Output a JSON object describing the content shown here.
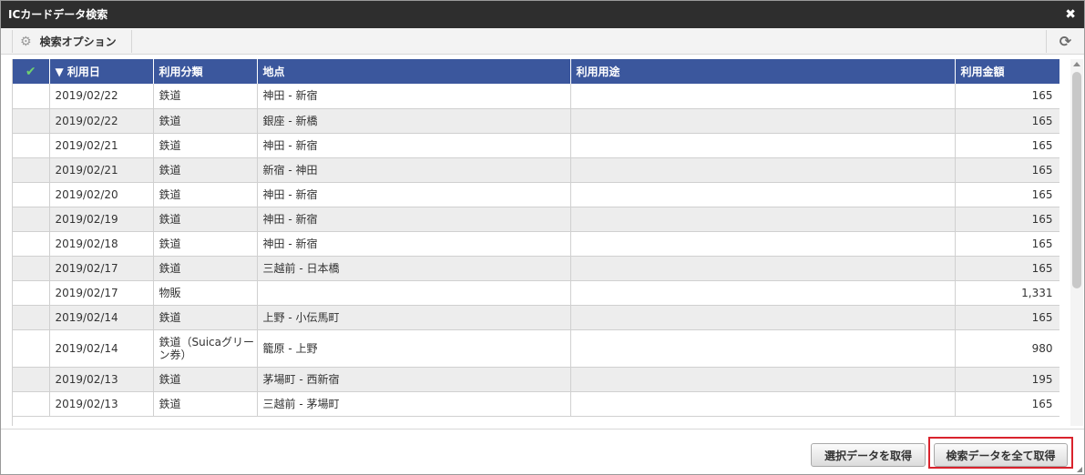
{
  "window": {
    "title": "ICカードデータ検索",
    "close_glyph": "✖"
  },
  "toolbar": {
    "search_options_label": "検索オプション",
    "refresh_glyph": "⟳"
  },
  "table": {
    "columns": {
      "check": "✔",
      "date": "▼ 利用日",
      "category": "利用分類",
      "location": "地点",
      "purpose": "利用用途",
      "amount": "利用金額"
    },
    "rows": [
      {
        "date": "2019/02/22",
        "category": "鉄道",
        "location": "神田 - 新宿",
        "purpose": "",
        "amount": "165"
      },
      {
        "date": "2019/02/22",
        "category": "鉄道",
        "location": "銀座 - 新橋",
        "purpose": "",
        "amount": "165"
      },
      {
        "date": "2019/02/21",
        "category": "鉄道",
        "location": "神田 - 新宿",
        "purpose": "",
        "amount": "165"
      },
      {
        "date": "2019/02/21",
        "category": "鉄道",
        "location": "新宿 - 神田",
        "purpose": "",
        "amount": "165"
      },
      {
        "date": "2019/02/20",
        "category": "鉄道",
        "location": "神田 - 新宿",
        "purpose": "",
        "amount": "165"
      },
      {
        "date": "2019/02/19",
        "category": "鉄道",
        "location": "神田 - 新宿",
        "purpose": "",
        "amount": "165"
      },
      {
        "date": "2019/02/18",
        "category": "鉄道",
        "location": "神田 - 新宿",
        "purpose": "",
        "amount": "165"
      },
      {
        "date": "2019/02/17",
        "category": "鉄道",
        "location": "三越前 - 日本橋",
        "purpose": "",
        "amount": "165"
      },
      {
        "date": "2019/02/17",
        "category": "物販",
        "location": "",
        "purpose": "",
        "amount": "1,331"
      },
      {
        "date": "2019/02/14",
        "category": "鉄道",
        "location": "上野 - 小伝馬町",
        "purpose": "",
        "amount": "165"
      },
      {
        "date": "2019/02/14",
        "category": "鉄道（Suicaグリーン券）",
        "location": "籠原 - 上野",
        "purpose": "",
        "amount": "980"
      },
      {
        "date": "2019/02/13",
        "category": "鉄道",
        "location": "茅場町 - 西新宿",
        "purpose": "",
        "amount": "195"
      },
      {
        "date": "2019/02/13",
        "category": "鉄道",
        "location": "三越前 - 茅場町",
        "purpose": "",
        "amount": "165"
      }
    ]
  },
  "footer": {
    "get_selected_label": "選択データを取得",
    "get_all_label": "検索データを全て取得"
  },
  "colors": {
    "header_bg": "#3b579d",
    "titlebar_bg": "#2e2e2e",
    "highlight": "#d9232d",
    "check": "#6fd16f"
  }
}
